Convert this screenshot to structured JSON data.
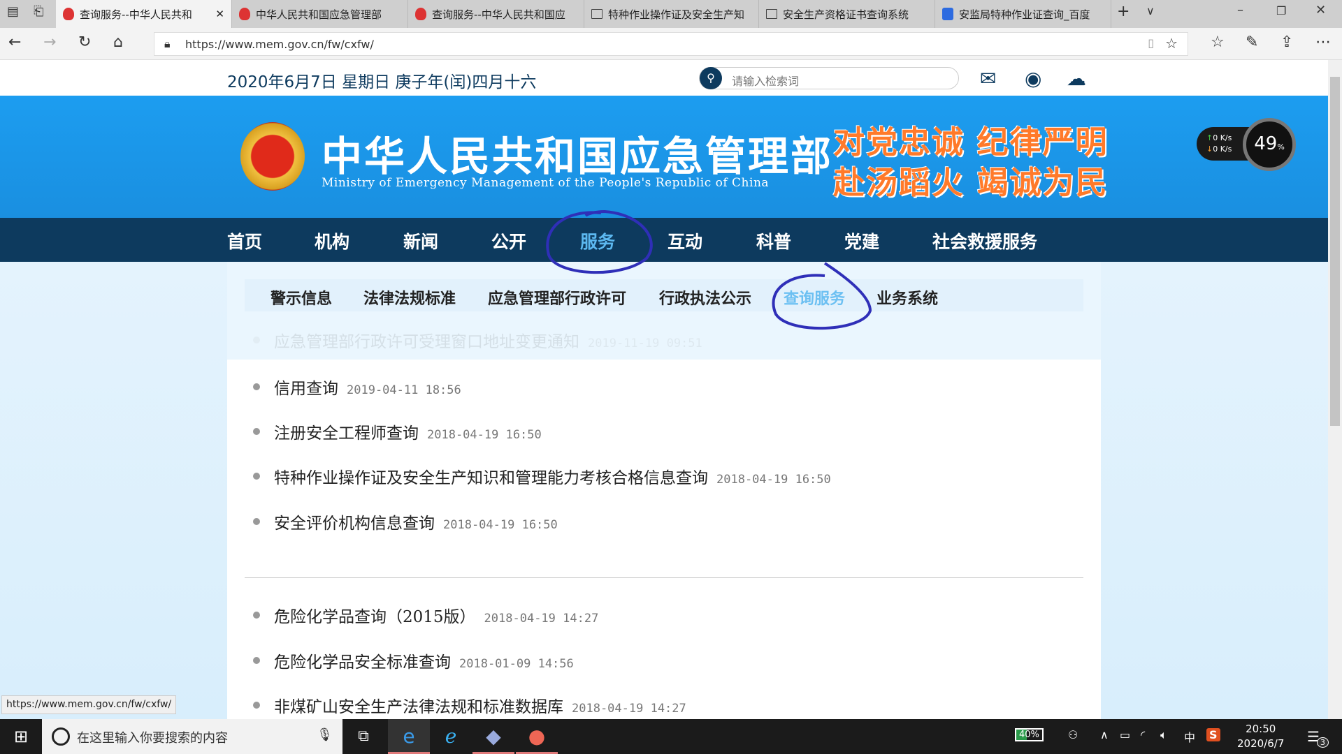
{
  "browser": {
    "tabs": [
      {
        "label": "查询服务--中华人民共和",
        "icon": "emblem"
      },
      {
        "label": "中华人民共和国应急管理部",
        "icon": "emblem"
      },
      {
        "label": "查询服务--中华人民共和国应",
        "icon": "emblem"
      },
      {
        "label": "特种作业操作证及安全生产知",
        "icon": "page"
      },
      {
        "label": "安全生产资格证书查询系统",
        "icon": "page"
      },
      {
        "label": "安监局特种作业证查询_百度",
        "icon": "baidu"
      }
    ],
    "url": "https://www.mem.gov.cn/fw/cxfw/",
    "status_url": "https://www.mem.gov.cn/fw/cxfw/"
  },
  "site": {
    "date": "2020年6月7日 星期日 庚子年(闰)四月十六",
    "search_placeholder": "请输入检索词",
    "title": "中华人民共和国应急管理部",
    "title_en": "Ministry of Emergency Management of the People's Republic of China",
    "slogan1": "对党忠诚 纪律严明",
    "slogan2": "赴汤蹈火 竭诚为民",
    "nav": [
      "首页",
      "机构",
      "新闻",
      "公开",
      "服务",
      "互动",
      "科普",
      "党建",
      "社会救援服务"
    ],
    "subnav": [
      "警示信息",
      "法律法规标准",
      "应急管理部行政许可",
      "行政执法公示",
      "查询服务",
      "业务系统"
    ],
    "faded_item": {
      "title": "应急管理部行政许可受理窗口地址变更通知",
      "date": "2019-11-19 09:51"
    },
    "list1": [
      {
        "title": "信用查询",
        "date": "2019-04-11 18:56"
      },
      {
        "title": "注册安全工程师查询",
        "date": "2018-04-19 16:50"
      },
      {
        "title": "特种作业操作证及安全生产知识和管理能力考核合格信息查询",
        "date": "2018-04-19 16:50"
      },
      {
        "title": "安全评价机构信息查询",
        "date": "2018-04-19 16:50"
      }
    ],
    "list2": [
      {
        "title": "危险化学品查询（2015版）",
        "date": "2018-04-19 14:27"
      },
      {
        "title": "危险化学品安全标准查询",
        "date": "2018-01-09 14:56"
      },
      {
        "title": "非煤矿山安全生产法律法规和标准数据库",
        "date": "2018-04-19 14:27"
      }
    ]
  },
  "widget": {
    "up": "0 K/s",
    "down": "0 K/s",
    "percent": "49",
    "unit": "%"
  },
  "taskbar": {
    "search_placeholder": "在这里输入你要搜索的内容",
    "battery": "40%",
    "ime": "中",
    "time": "20:50",
    "date": "2020/6/7",
    "notifications": "3"
  }
}
